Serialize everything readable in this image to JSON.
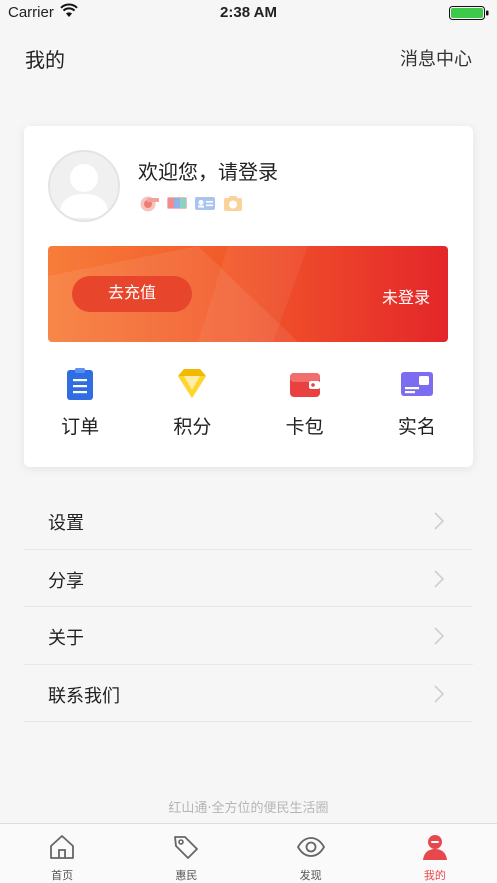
{
  "status_bar": {
    "carrier": "Carrier",
    "time": "2:38 AM"
  },
  "header": {
    "title": "我的",
    "message_center": "消息中心"
  },
  "profile": {
    "welcome": "欢迎您，请登录",
    "mini_icons": [
      "bank-card-icon",
      "union-card-icon",
      "id-card-icon",
      "camera-icon"
    ]
  },
  "banner": {
    "recharge_label": "去充值",
    "login_state": "未登录"
  },
  "quick_actions": [
    {
      "label": "订单",
      "icon": "order-icon",
      "color": "#2f6de1"
    },
    {
      "label": "积分",
      "icon": "diamond-icon",
      "color": "#f5b800"
    },
    {
      "label": "卡包",
      "icon": "wallet-icon",
      "color": "#e94040"
    },
    {
      "label": "实名",
      "icon": "id-card-icon",
      "color": "#7b6cf0"
    }
  ],
  "menu": [
    {
      "label": "设置"
    },
    {
      "label": "分享"
    },
    {
      "label": "关于"
    },
    {
      "label": "联系我们"
    }
  ],
  "slogan": "红山通·全方位的便民生活圈",
  "tabs": [
    {
      "label": "首页",
      "icon": "home-icon",
      "active": false
    },
    {
      "label": "惠民",
      "icon": "tag-icon",
      "active": false
    },
    {
      "label": "发现",
      "icon": "eye-icon",
      "active": false
    },
    {
      "label": "我的",
      "icon": "user-icon",
      "active": true
    }
  ],
  "colors": {
    "accent": "#e6484e",
    "banner_start": "#f77d3a",
    "banner_end": "#e4262a"
  }
}
